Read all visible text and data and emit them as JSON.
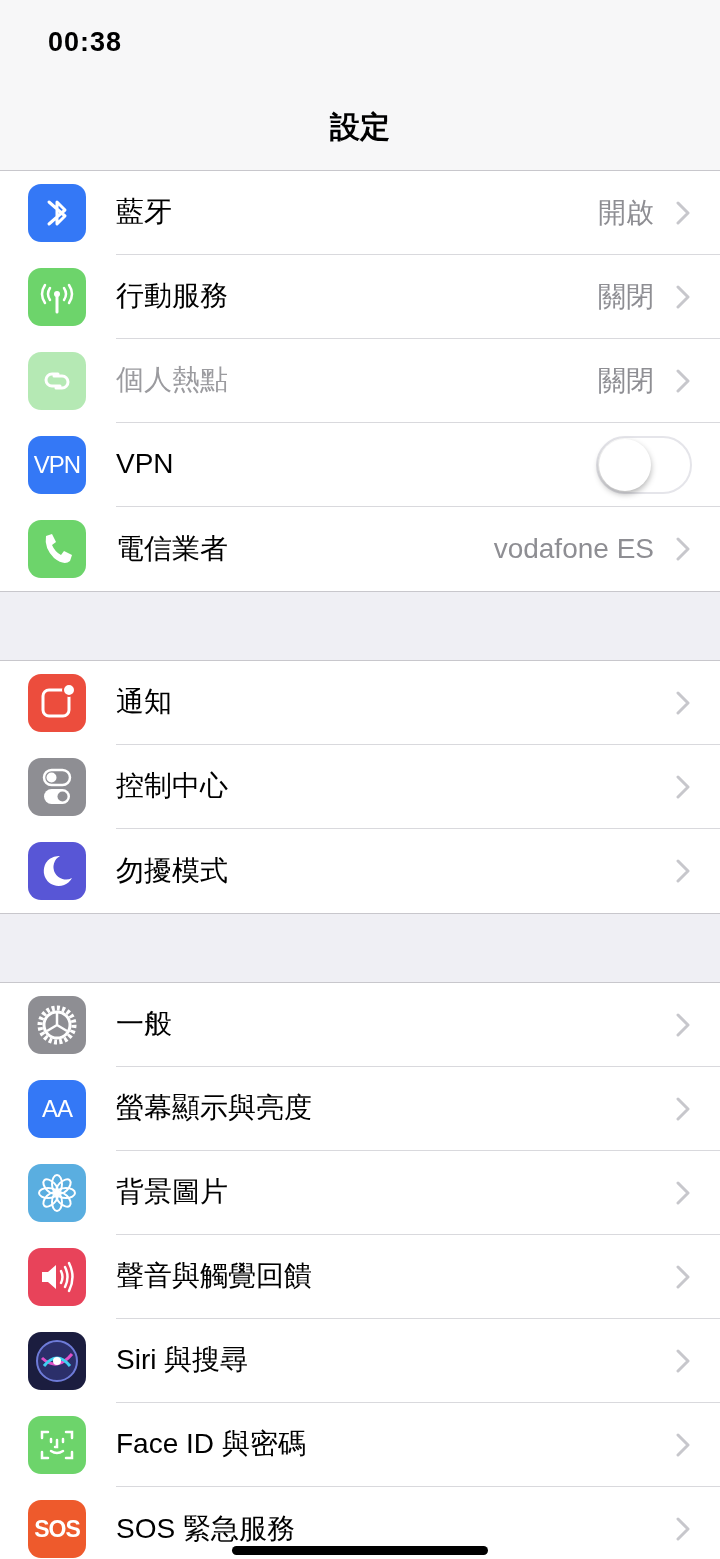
{
  "status_bar": {
    "time": "00:38"
  },
  "title": "設定",
  "sections": [
    {
      "items": [
        {
          "kind": "link",
          "label": "藍牙",
          "value": "開啟",
          "disabled": false
        },
        {
          "kind": "link",
          "label": "行動服務",
          "value": "關閉",
          "disabled": false
        },
        {
          "kind": "link",
          "label": "個人熱點",
          "value": "關閉",
          "disabled": true
        },
        {
          "kind": "toggle",
          "label": "VPN",
          "icon_text": "VPN",
          "on": false,
          "disabled": false
        },
        {
          "kind": "link",
          "label": "電信業者",
          "value": "vodafone ES",
          "disabled": false
        }
      ]
    },
    {
      "items": [
        {
          "kind": "link",
          "label": "通知",
          "disabled": false
        },
        {
          "kind": "link",
          "label": "控制中心",
          "disabled": false
        },
        {
          "kind": "link",
          "label": "勿擾模式",
          "disabled": false
        }
      ]
    },
    {
      "items": [
        {
          "kind": "link",
          "label": "一般",
          "disabled": false
        },
        {
          "kind": "link",
          "label": "螢幕顯示與亮度",
          "icon_text": "AA",
          "disabled": false
        },
        {
          "kind": "link",
          "label": "背景圖片",
          "disabled": false
        },
        {
          "kind": "link",
          "label": "聲音與觸覺回饋",
          "disabled": false
        },
        {
          "kind": "link",
          "label": "Siri 與搜尋",
          "disabled": false
        },
        {
          "kind": "link",
          "label": "Face ID 與密碼",
          "disabled": false
        },
        {
          "kind": "link",
          "label": "SOS 緊急服務",
          "icon_text": "SOS",
          "disabled": false
        }
      ]
    }
  ]
}
